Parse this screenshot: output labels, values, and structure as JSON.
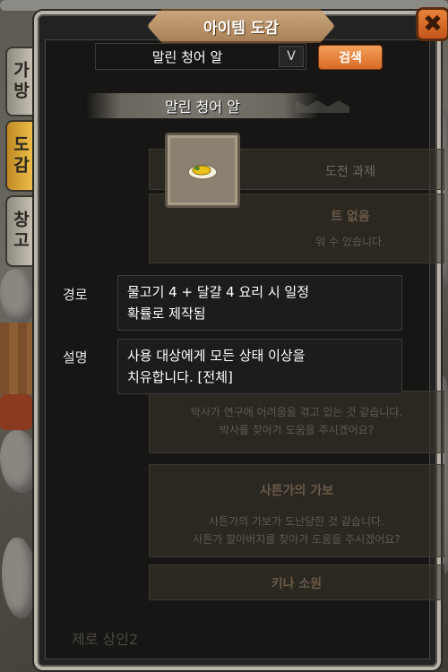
{
  "window": {
    "title": "아이템 도감",
    "close_icon": "close-x-icon"
  },
  "side_tabs": [
    {
      "label": "가방",
      "active": false
    },
    {
      "label": "도감",
      "active": true
    },
    {
      "label": "창고",
      "active": false
    }
  ],
  "search": {
    "selected_value": "말린 청어 알",
    "dropdown_arrow": "V",
    "button_label": "검색"
  },
  "item": {
    "name": "말린 청어 알",
    "icon": "dried-herring-roe-icon"
  },
  "info": {
    "route_label": "경로",
    "route_text_line1": "물고기 4 + 달걀 4 요리 시 일정",
    "route_text_line2": "확률로 제작됨",
    "desc_label": "설명",
    "desc_text_line1": "사용 대상에게 모든 상태 이상을",
    "desc_text_line2": "치유합니다. [전체]"
  },
  "background_list": {
    "challenge_tab": "도전 과제",
    "quest_hint_1": "트 없음",
    "quest_hint_2": "워 수 있습니다.",
    "entry1_line1": "박사가 연구에 어려움을 겪고 있는 것 같습니다.",
    "entry1_line2": "박사를 찾아가 도움을 주시겠어요?",
    "entry2_title": "사튼가의 가보",
    "entry2_line1": "사튼가의 가보가 도난당한 것 같습니다.",
    "entry2_line2": "사튼가 할아버지를 찾아가 도움을 주시겠어요?",
    "entry3_title": "키나 소원",
    "npc_name": "제로 상인2"
  },
  "colors": {
    "accent_orange": "#d86a26",
    "active_tab": "#f0c04a",
    "panel_bg": "#181614"
  }
}
